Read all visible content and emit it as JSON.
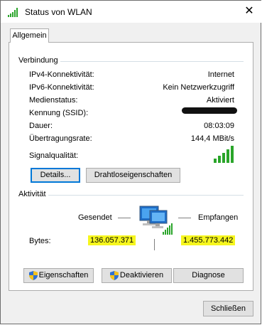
{
  "window": {
    "title": "Status von WLAN",
    "close_glyph": "✕"
  },
  "tabs": [
    {
      "label": "Allgemein"
    }
  ],
  "connection": {
    "group_label": "Verbindung",
    "rows": [
      {
        "label": "IPv4-Konnektivität:",
        "value": "Internet"
      },
      {
        "label": "IPv6-Konnektivität:",
        "value": "Kein Netzwerkzugriff"
      },
      {
        "label": "Medienstatus:",
        "value": "Aktiviert"
      },
      {
        "label": "Kennung (SSID):",
        "value": ""
      },
      {
        "label": "Dauer:",
        "value": "08:03:09"
      },
      {
        "label": "Übertragungsrate:",
        "value": "144,4 MBit/s"
      }
    ],
    "signal_label": "Signalqualität:",
    "signal_level": "5 of 5 bars",
    "details_button": "Details...",
    "wireless_props_button": "Drahtloseigenschaften"
  },
  "activity": {
    "group_label": "Aktivität",
    "sent_label": "Gesendet",
    "received_label": "Empfangen",
    "bytes_label": "Bytes:",
    "bytes_sent": "136.057.371",
    "bytes_received": "1.455.773.442",
    "highlight_color": "#f6f61e"
  },
  "buttons": {
    "properties": "Eigenschaften",
    "disable": "Deaktivieren",
    "diagnose": "Diagnose",
    "close": "Schließen"
  },
  "colors": {
    "signal_green": "#2aa52a",
    "focus_blue": "#0078d7"
  }
}
